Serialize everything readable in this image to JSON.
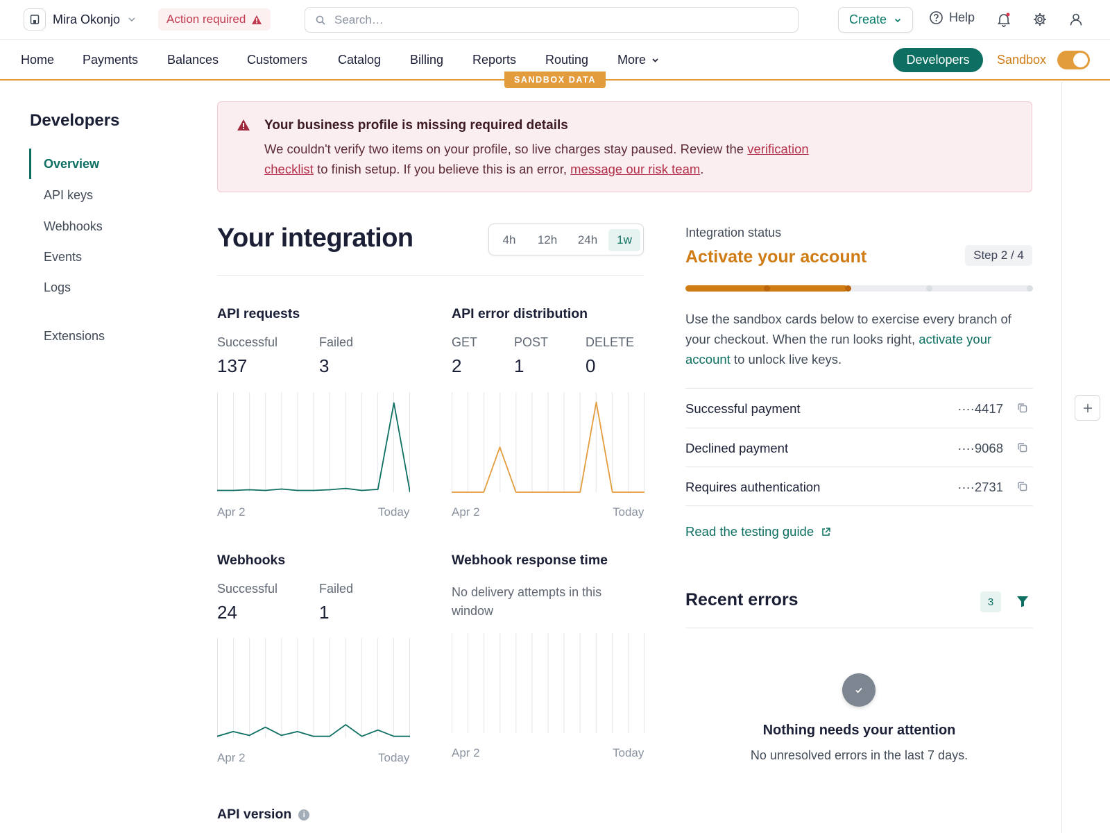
{
  "topbar": {
    "account_name": "Mira Okonjo",
    "action_required": "Action required",
    "search_placeholder": "Search…",
    "create_label": "Create",
    "help_label": "Help"
  },
  "nav": {
    "items": [
      "Home",
      "Payments",
      "Balances",
      "Customers",
      "Catalog",
      "Billing",
      "Reports",
      "Routing",
      "More"
    ],
    "sandbox_tag": "SANDBOX DATA",
    "developers_label": "Developers",
    "sandbox_label": "Sandbox",
    "sandbox_enabled": true
  },
  "sidebar": {
    "title": "Developers",
    "items": [
      "Overview",
      "API keys",
      "Webhooks",
      "Events",
      "Logs",
      "Extensions"
    ],
    "active": "Overview"
  },
  "banner": {
    "title": "Your business profile is missing required details",
    "text_1": "We couldn't verify two items on your profile, so live charges stay paused. Review the ",
    "link_1": "verification checklist",
    "text_2": " to finish setup. If you believe this is an error, ",
    "link_2": "message our risk team",
    "text_3": "."
  },
  "integration": {
    "title": "Your integration",
    "ranges": [
      "4h",
      "12h",
      "24h",
      "1w"
    ],
    "selected_range": "1w"
  },
  "panels": {
    "api_requests": {
      "title": "API requests",
      "stats": [
        {
          "label": "Successful",
          "value": "137"
        },
        {
          "label": "Failed",
          "value": "3"
        }
      ],
      "x_start": "Apr 2",
      "x_end": "Today"
    },
    "api_errors": {
      "title": "API error distribution",
      "stats": [
        {
          "label": "GET",
          "value": "2"
        },
        {
          "label": "POST",
          "value": "1"
        },
        {
          "label": "DELETE",
          "value": "0"
        }
      ],
      "x_start": "Apr 2",
      "x_end": "Today"
    },
    "webhooks": {
      "title": "Webhooks",
      "stats": [
        {
          "label": "Successful",
          "value": "24"
        },
        {
          "label": "Failed",
          "value": "1"
        }
      ],
      "x_start": "Apr 2",
      "x_end": "Today"
    },
    "webhook_response": {
      "title": "Webhook response time",
      "empty_text": "No delivery attempts in this window",
      "x_start": "Apr 2",
      "x_end": "Today"
    }
  },
  "api_version": {
    "title": "API version"
  },
  "status": {
    "label": "Integration status",
    "title": "Activate your account",
    "step": "Step 2 / 4",
    "step_current": 2,
    "step_total": 4,
    "desc_1": "Use the sandbox cards below to exercise every branch of your checkout. When the run looks right, ",
    "desc_link": "activate your account",
    "desc_2": " to unlock live keys.",
    "cards": [
      {
        "name": "Successful payment",
        "number": "····4417"
      },
      {
        "name": "Declined payment",
        "number": "····9068"
      },
      {
        "name": "Requires authentication",
        "number": "····2731"
      }
    ],
    "guide_label": "Read the testing guide"
  },
  "recent_errors": {
    "title": "Recent errors",
    "count": "3",
    "empty_title": "Nothing needs your attention",
    "empty_sub": "No unresolved errors in the last 7 days."
  },
  "chart_data": [
    {
      "type": "line",
      "title": "API requests",
      "x_start": "Apr 2",
      "x_end": "Today",
      "series": [
        {
          "name": "Successful",
          "values": [
            1,
            1,
            1.4,
            1,
            1.8,
            1,
            1,
            1.4,
            2.2,
            1,
            1.6,
            52,
            0
          ]
        }
      ],
      "color": "#0d6f61",
      "ymax": 55
    },
    {
      "type": "line",
      "title": "API error distribution",
      "x_start": "Apr 2",
      "x_end": "Today",
      "series": [
        {
          "values": [
            0,
            0,
            0,
            1,
            0,
            0,
            0,
            0,
            0,
            2,
            0,
            0,
            0
          ]
        }
      ],
      "color": "#e39c3c",
      "ymax": 2.1
    },
    {
      "type": "line",
      "title": "Webhooks",
      "x_start": "Apr 2",
      "x_end": "Today",
      "series": [
        {
          "name": "Successful",
          "values": [
            0.5,
            2,
            0.8,
            3.4,
            0.8,
            2,
            0.5,
            0.5,
            4.2,
            0.5,
            2.5,
            0.5,
            0.5
          ]
        }
      ],
      "color": "#0d6f61",
      "ymax": 30
    },
    {
      "type": "line",
      "title": "Webhook response time",
      "x_start": "Apr 2",
      "x_end": "Today",
      "series": [],
      "color": "#0d6f61",
      "ymax": 1
    }
  ]
}
